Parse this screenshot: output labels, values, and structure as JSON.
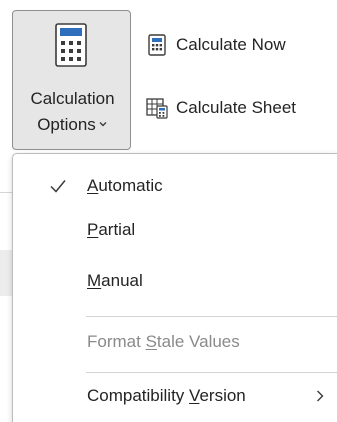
{
  "ribbon": {
    "calc_options": {
      "line1": "Calculation",
      "line2": "Options",
      "icon": "calculator-icon"
    },
    "calculate_now": {
      "label": "Calculate Now",
      "icon": "calculator-small-icon"
    },
    "calculate_sheet": {
      "label": "Calculate Sheet",
      "icon": "sheet-calculator-icon"
    }
  },
  "menu": {
    "items": [
      {
        "pre": "",
        "mnemonic": "A",
        "post": "utomatic",
        "checked": true,
        "disabled": false
      },
      {
        "pre": "",
        "mnemonic": "P",
        "post": "artial",
        "checked": false,
        "disabled": false
      },
      {
        "pre": "",
        "mnemonic": "M",
        "post": "anual",
        "checked": false,
        "disabled": false
      },
      {
        "pre": "Format ",
        "mnemonic": "S",
        "post": "tale Values",
        "checked": false,
        "disabled": true
      },
      {
        "pre": "Compatibility ",
        "mnemonic": "V",
        "post": "ersion",
        "checked": false,
        "disabled": false,
        "submenu": true
      }
    ]
  },
  "colors": {
    "button_bg": "#e6e6e6",
    "button_border": "#8f8f8f",
    "text": "#242424",
    "disabled_text": "#8a8a8a",
    "icon_blue": "#2f6ebd"
  }
}
